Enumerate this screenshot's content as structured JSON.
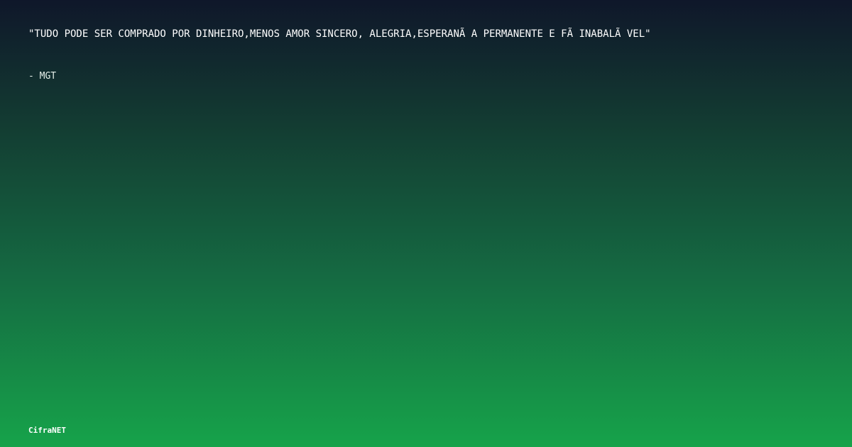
{
  "quote": {
    "text": "\"TUDO PODE SER COMPRADO POR DINHEIRO,MENOS AMOR SINCERO, ALEGRIA,ESPERANÃ A PERMANENTE E FÃ  INABALÃ VEL\"",
    "author": "- MGT"
  },
  "brand": {
    "name": "CifraNET"
  },
  "colors": {
    "gradient_top": "#0f172a",
    "gradient_bottom": "#16a34a",
    "text": "#ffffff"
  }
}
